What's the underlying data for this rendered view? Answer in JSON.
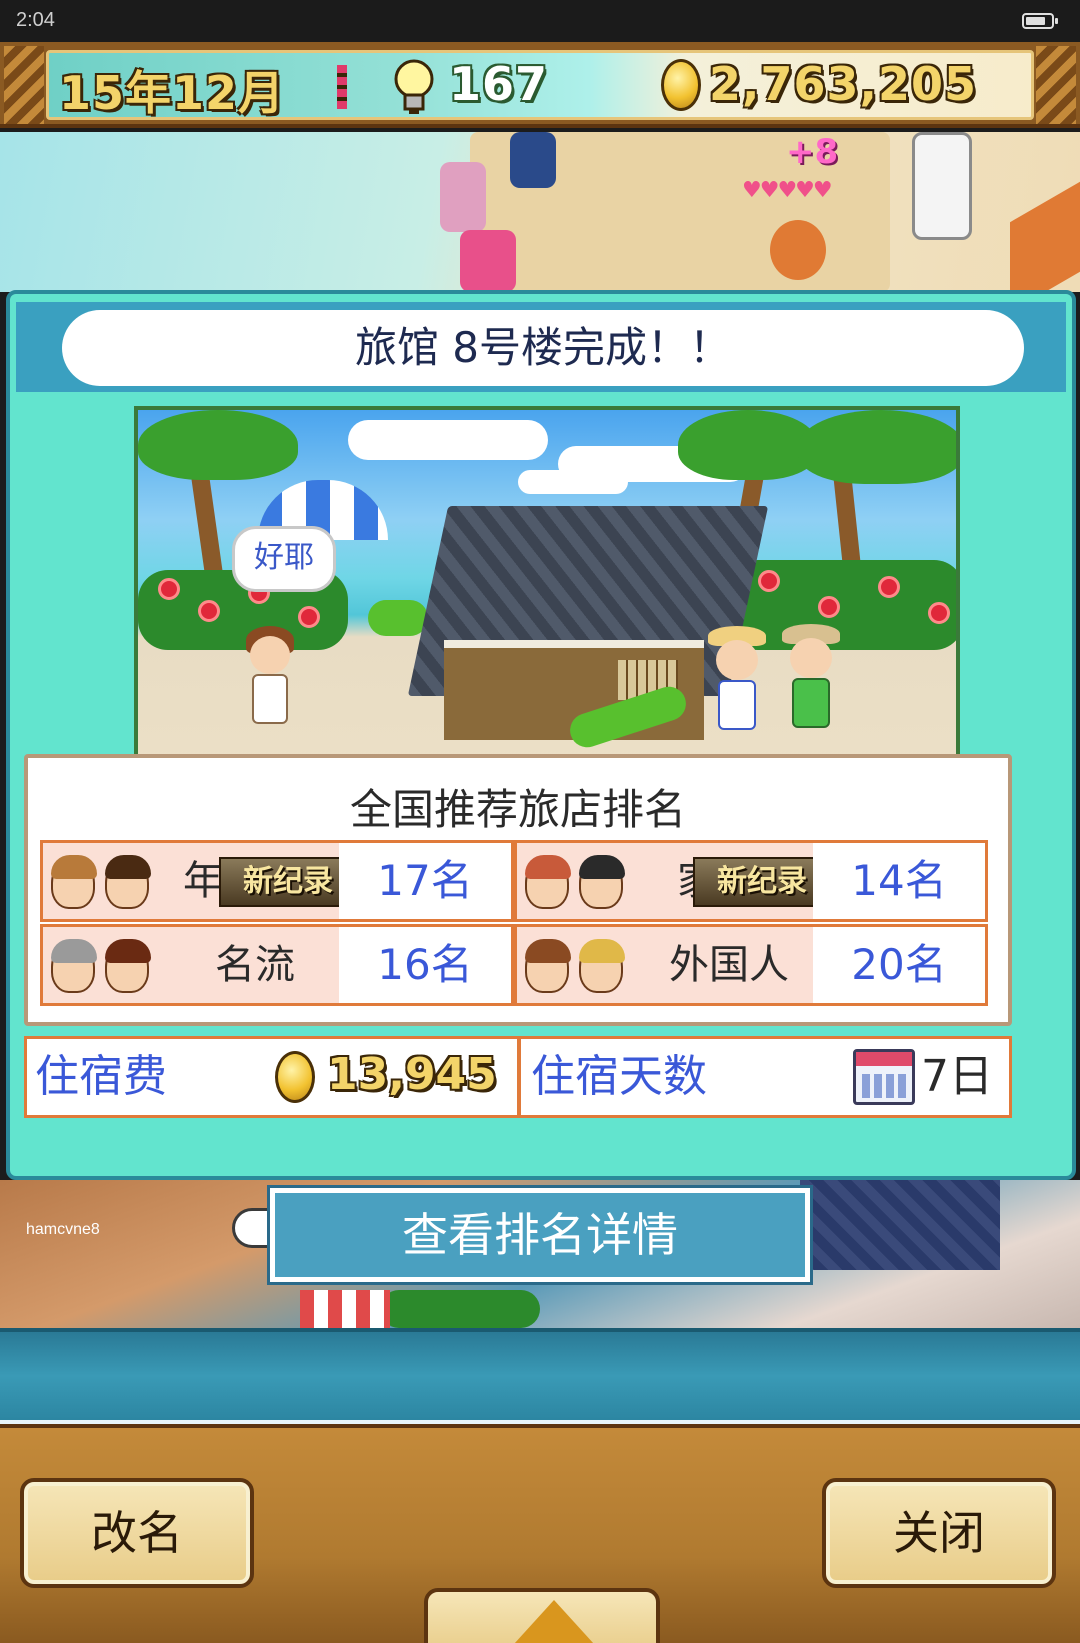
{
  "status_bar": {
    "time": "2:04"
  },
  "hud": {
    "date": "15年12月",
    "idea_points": "167",
    "money": "2,763,205"
  },
  "dialog": {
    "title": "旅馆 8号楼完成！！",
    "speech_bubble": "好耶",
    "ranking": {
      "title": "全国推荐旅店排名",
      "record_badge": "新纪录",
      "cells": [
        {
          "label": "年",
          "value": "17名",
          "new_record": true
        },
        {
          "label": "家",
          "value": "14名",
          "new_record": true
        },
        {
          "label": "名流",
          "value": "16名",
          "new_record": false
        },
        {
          "label": "外国人",
          "value": "20名",
          "new_record": false
        }
      ]
    },
    "fee_label": "住宿费",
    "fee_value": "13,945",
    "days_label": "住宿天数",
    "days_value": "7日"
  },
  "watermark": "hamcvne8",
  "detail_button": "查看排名详情",
  "footer": {
    "rename_button": "改名",
    "close_button": "关闭"
  },
  "colors": {
    "dialog_bg": "#62e4ce",
    "title_band": "#3aa0c0",
    "rank_value_text": "#3a58d8",
    "cell_border": "#e07a3a",
    "hud_gold": "#f3d46a"
  },
  "icons": [
    "battery-icon",
    "lightbulb-icon",
    "coin-icon",
    "calendar-icon",
    "pointing-hand-icon",
    "up-arrow-icon"
  ]
}
